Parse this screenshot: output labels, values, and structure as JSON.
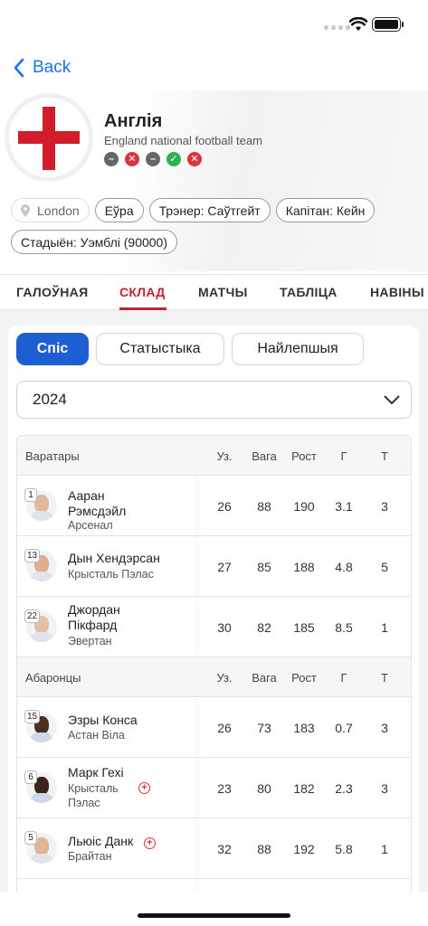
{
  "nav": {
    "back_label": "Back"
  },
  "team": {
    "name": "Англія",
    "subtitle": "England national football team",
    "form": [
      "draw",
      "loss",
      "draw",
      "win",
      "loss"
    ],
    "location": "London",
    "tags": [
      "Еўра",
      "Трэнер: Саўтгейт",
      "Капітан: Кейн",
      "Стадыён: Уэмблі (90000)"
    ]
  },
  "tabs": [
    "ГАЛОЎНАЯ",
    "СКЛАД",
    "МАТЧЫ",
    "ТАБЛІЦА",
    "НАВІНЫ"
  ],
  "active_tab": "СКЛАД",
  "segments": [
    "Спіс",
    "Статыстыка",
    "Найлепшыя"
  ],
  "active_segment": "Спіс",
  "season": {
    "value": "2024"
  },
  "columns": [
    "Уз.",
    "Вага",
    "Рост",
    "Г",
    "Т"
  ],
  "groups": [
    {
      "title": "Варатары",
      "players": [
        {
          "number": "1",
          "first": "Ааран",
          "last": "Рэмсдэйл",
          "club": "Арсенал",
          "apps": "26",
          "weight": "88",
          "height": "190",
          "goals": "3.1",
          "t": "3"
        },
        {
          "number": "13",
          "first": "Дын Хендэрсан",
          "last": "",
          "club": "Крысталь Пэлас",
          "apps": "27",
          "weight": "85",
          "height": "188",
          "goals": "4.8",
          "t": "5"
        },
        {
          "number": "22",
          "first": "Джордан",
          "last": "Пікфард",
          "club": "Эвертан",
          "apps": "30",
          "weight": "82",
          "height": "185",
          "goals": "8.5",
          "t": "1"
        }
      ]
    },
    {
      "title": "Абаронцы",
      "players": [
        {
          "number": "15",
          "first": "Эзры Конса",
          "last": "",
          "club": "Астан Віла",
          "apps": "26",
          "weight": "73",
          "height": "183",
          "goals": "0.7",
          "t": "3"
        },
        {
          "number": "6",
          "first": "Марк Гехі",
          "last": "",
          "club": "Крысталь Пэлас",
          "apps": "23",
          "weight": "80",
          "height": "182",
          "goals": "2.3",
          "t": "3",
          "injured": true
        },
        {
          "number": "5",
          "first": "Льюіс Данк",
          "last": "",
          "club": "Брайтан",
          "apps": "32",
          "weight": "88",
          "height": "192",
          "goals": "5.8",
          "t": "1",
          "injured": true
        }
      ]
    }
  ],
  "colors": {
    "accent_blue": "#1d5fd3",
    "accent_red": "#c2242f",
    "win": "#2db24f",
    "loss": "#e0323c",
    "draw": "#666666"
  }
}
